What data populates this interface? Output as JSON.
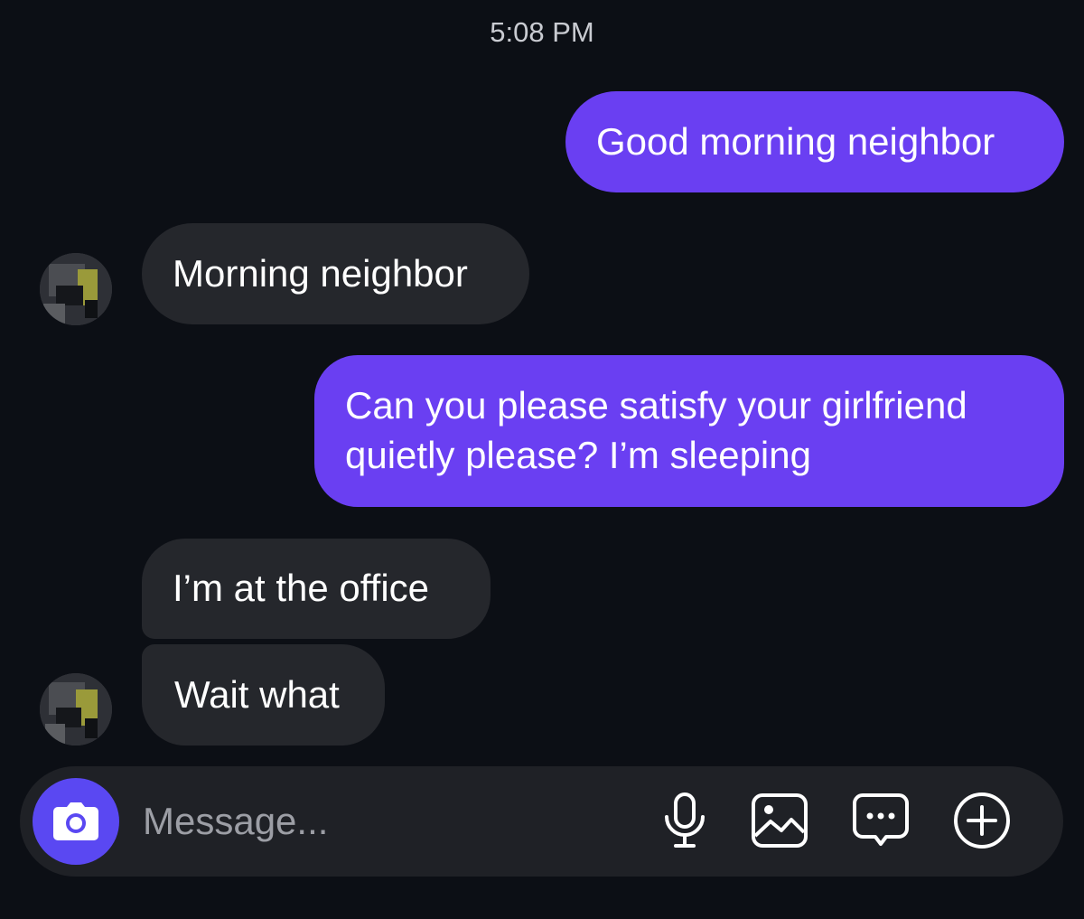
{
  "header": {
    "timestamp": "5:08 PM"
  },
  "messages": [
    {
      "direction": "outgoing",
      "text": "Good morning neighbor"
    },
    {
      "direction": "incoming",
      "text": "Morning neighbor"
    },
    {
      "direction": "outgoing",
      "text": "Can you please satisfy your girlfriend quietly please? I’m sleeping"
    },
    {
      "direction": "incoming",
      "text": "I’m at the office"
    },
    {
      "direction": "incoming",
      "text": "Wait what"
    }
  ],
  "composer": {
    "placeholder": "Message...",
    "value": "",
    "icons": [
      "camera-icon",
      "microphone-icon",
      "gallery-icon",
      "sticker-chat-icon",
      "plus-circle-icon"
    ]
  },
  "colors": {
    "background": "#0c0f15",
    "outgoing_bubble": "#6a3ff2",
    "incoming_bubble": "#25272c",
    "camera_button": "#5a48f2",
    "composer": "#1f2126"
  }
}
